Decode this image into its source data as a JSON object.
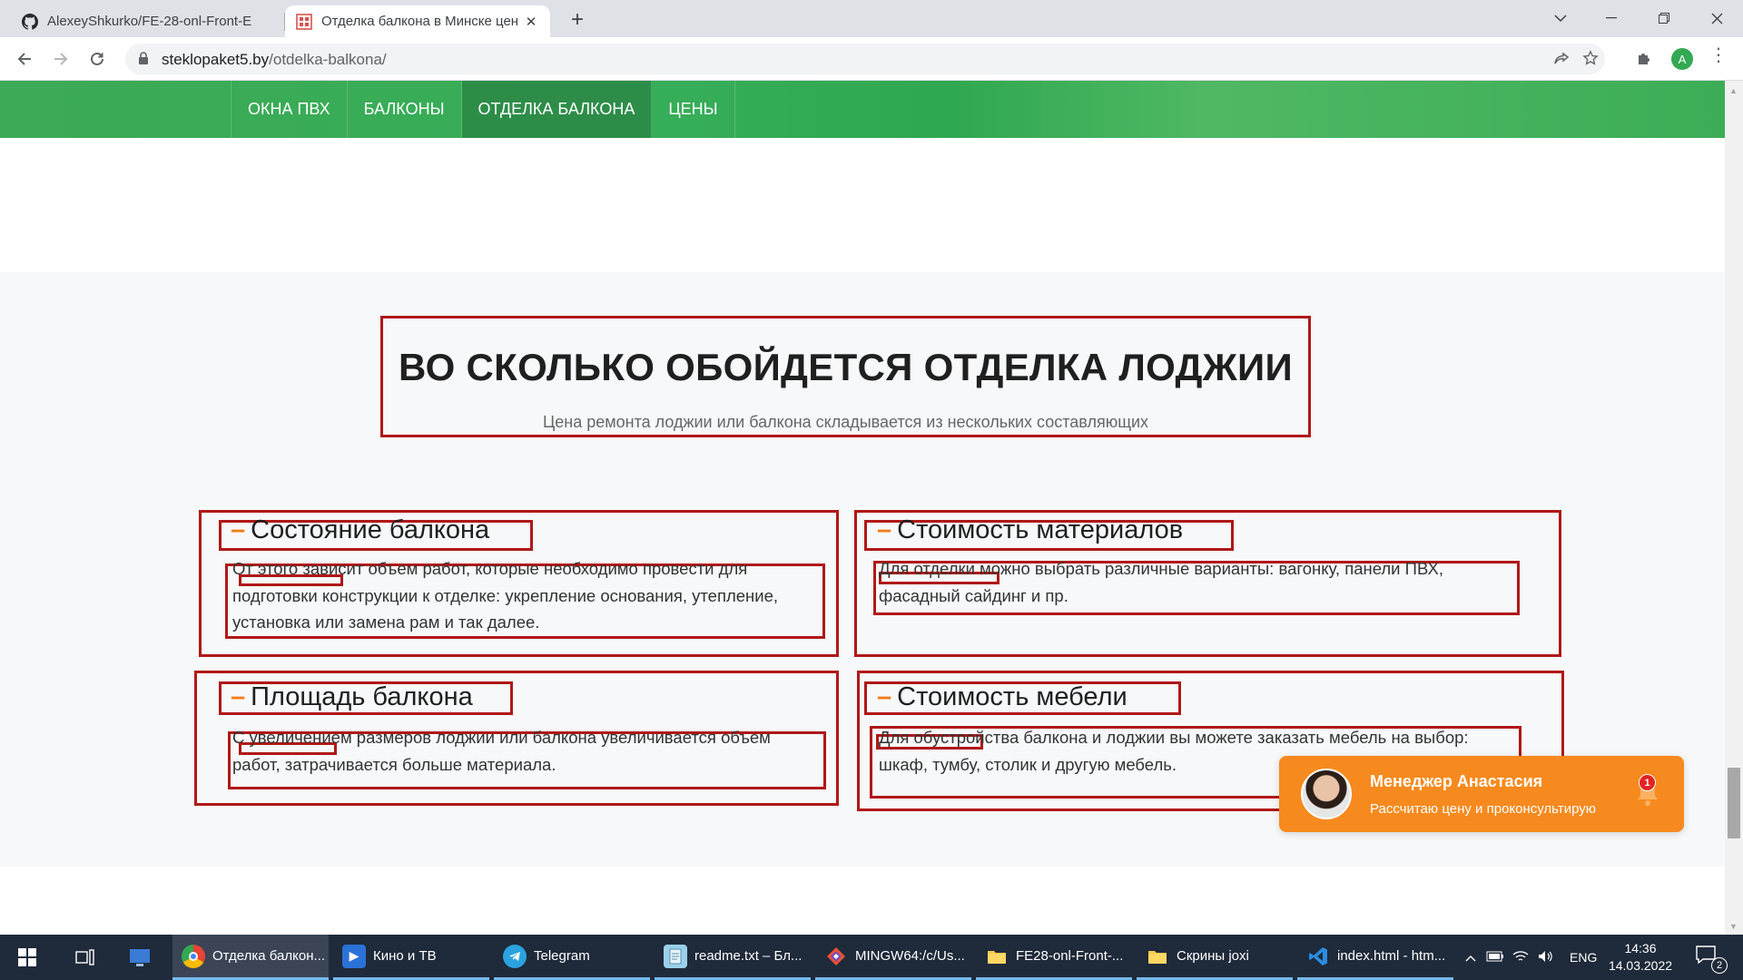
{
  "browser": {
    "tabs": [
      {
        "title": "AlexeyShkurko/FE-28-onl-Front-E"
      },
      {
        "title": "Отделка балкона в Минске цен"
      }
    ],
    "url_host": "steklopaket5.by",
    "url_path": "/otdelka-balkona/",
    "profile_initial": "A"
  },
  "site": {
    "nav": [
      {
        "label": "ОКНА ПВХ"
      },
      {
        "label": "БАЛКОНЫ"
      },
      {
        "label": "ОТДЕЛКА БАЛКОНА",
        "active": true
      },
      {
        "label": "ЦЕНЫ"
      }
    ],
    "colors": {
      "nav": "#3caa56",
      "accent": "#f07d1a",
      "annotation": "#b01818",
      "chat": "#f78a1e"
    },
    "section": {
      "title": "ВО СКОЛЬКО ОБОЙДЕТСЯ ОТДЕЛКА ЛОДЖИИ",
      "subtitle": "Цена ремонта лоджии или балкона складывается из нескольких составляющих",
      "cards": [
        {
          "title": "Состояние балкона",
          "text": "От этого зависит объем работ, которые необходимо провести для подготовки конструкции к отделке: укрепление основания, утепление, установка или замена рам и так далее."
        },
        {
          "title": "Стоимость материалов",
          "text": "Для отделки можно выбрать различные варианты: вагонку, панели ПВХ, фасадный сайдинг и пр."
        },
        {
          "title": "Площадь балкона",
          "text": "С увеличением размеров лоджии или балкона увеличивается объем работ, затрачивается больше материала."
        },
        {
          "title": "Стоимость мебели",
          "text": "Для обустройства балкона и лоджии вы можете заказать мебель на выбор: шкаф, тумбу, столик и другую мебель."
        }
      ],
      "dash": "–"
    },
    "chat": {
      "name": "Менеджер Анастасия",
      "description": "Рассчитаю цену и проконсультирую",
      "badge": "1"
    }
  },
  "taskbar": {
    "items": [
      {
        "label": "Отделка балкон..."
      },
      {
        "label": "Кино и ТВ"
      },
      {
        "label": "Telegram"
      },
      {
        "label": "readme.txt – Бл..."
      },
      {
        "label": "MINGW64:/c/Us..."
      },
      {
        "label": "FE28-onl-Front-..."
      },
      {
        "label": "Скрины joxi"
      },
      {
        "label": "index.html - htm..."
      }
    ],
    "language": "ENG",
    "time": "14:36",
    "date": "14.03.2022",
    "notifications": "2"
  }
}
